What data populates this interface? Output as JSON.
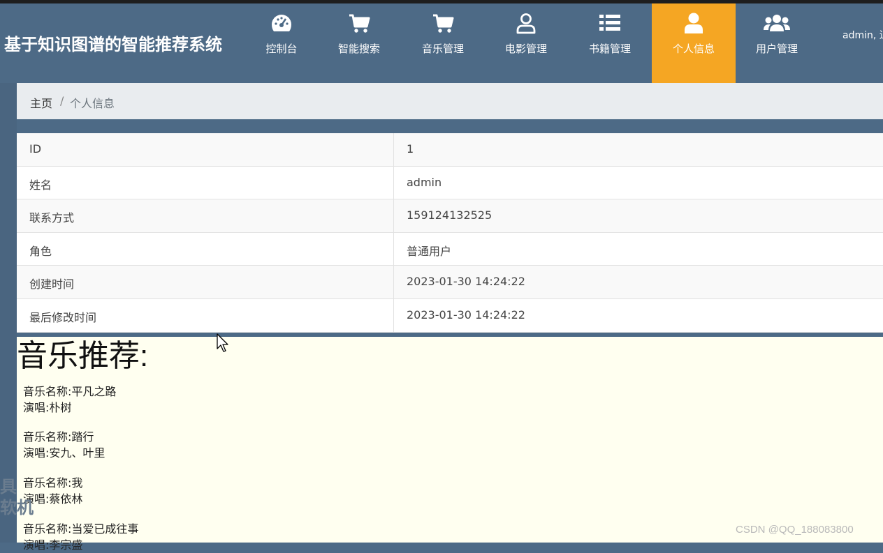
{
  "app": {
    "title": "基于知识图谱的智能推荐系统"
  },
  "nav": {
    "items": [
      {
        "label": "控制台",
        "icon": "dashboard-icon",
        "active": false
      },
      {
        "label": "智能搜索",
        "icon": "cart-icon",
        "active": false
      },
      {
        "label": "音乐管理",
        "icon": "cart-icon",
        "active": false
      },
      {
        "label": "电影管理",
        "icon": "user-outline-icon",
        "active": false
      },
      {
        "label": "书籍管理",
        "icon": "list-icon",
        "active": false
      },
      {
        "label": "个人信息",
        "icon": "user-icon",
        "active": true
      },
      {
        "label": "用户管理",
        "icon": "users-icon",
        "active": false
      }
    ],
    "user_text": "admin, 退出登录"
  },
  "breadcrumb": {
    "home": "主页",
    "separator": "/",
    "current": "个人信息"
  },
  "profile": {
    "rows": [
      {
        "key": "ID",
        "value": "1"
      },
      {
        "key": "姓名",
        "value": "admin"
      },
      {
        "key": "联系方式",
        "value": "159124132525"
      },
      {
        "key": "角色",
        "value": "普通用户"
      },
      {
        "key": "创建时间",
        "value": "2023-01-30 14:24:22"
      },
      {
        "key": "最后修改时间",
        "value": "2023-01-30 14:24:22"
      }
    ]
  },
  "music": {
    "title": "音乐推荐:",
    "items": [
      {
        "name": "音乐名称:平凡之路",
        "singer": "演唱:朴树"
      },
      {
        "name": "音乐名称:踏行",
        "singer": "演唱:安九、叶里"
      },
      {
        "name": "音乐名称:我",
        "singer": "演唱:蔡依林"
      },
      {
        "name": "音乐名称:当爱已成往事",
        "singer": "演唱:李宗盛"
      }
    ]
  },
  "overlay": {
    "line1": "具",
    "line2": "软机"
  },
  "watermark": "CSDN @QQ_188083800",
  "colors": {
    "nav_bg": "#4d6a86",
    "active": "#f5a623",
    "panel_bg": "#fffff0"
  }
}
